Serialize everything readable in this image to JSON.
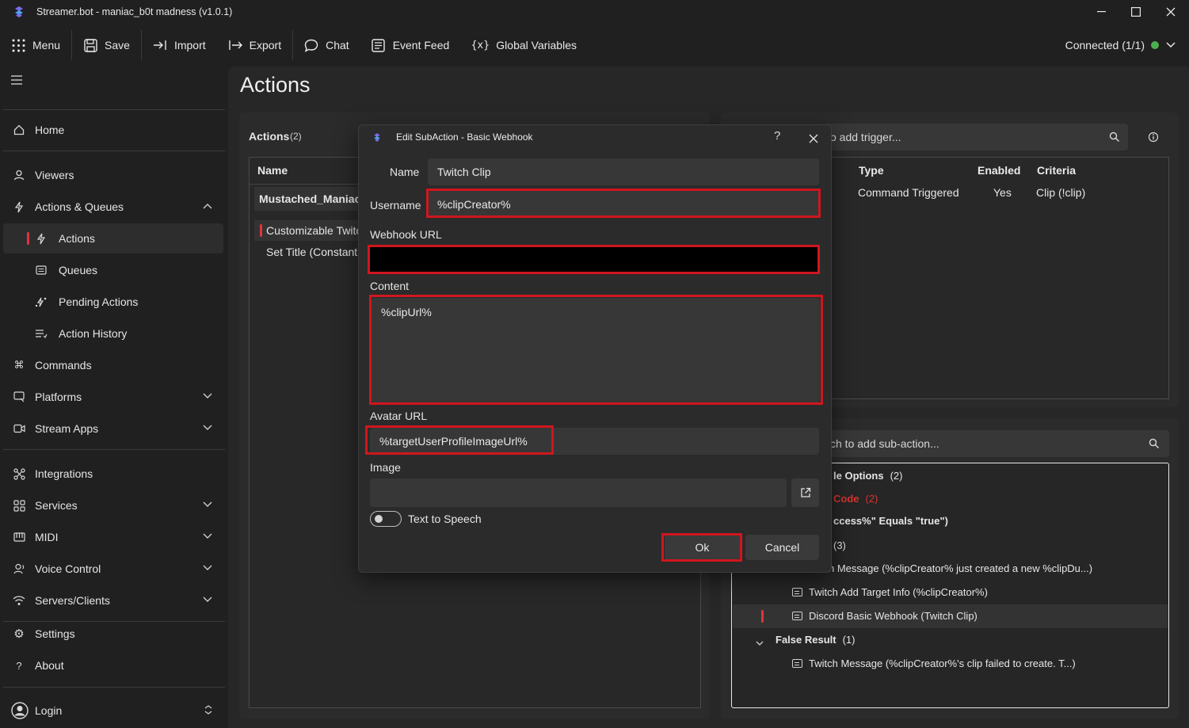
{
  "window": {
    "title": "Streamer.bot - maniac_b0t madness (v1.0.1)"
  },
  "toolbar": {
    "items": [
      {
        "label": "Menu",
        "icon": "grid-icon"
      },
      {
        "label": "Save",
        "icon": "floppy-icon"
      },
      {
        "label": "Import",
        "icon": "import-icon"
      },
      {
        "label": "Export",
        "icon": "export-icon"
      },
      {
        "label": "Chat",
        "icon": "chat-icon"
      },
      {
        "label": "Event Feed",
        "icon": "feed-icon"
      },
      {
        "label": "Global Variables",
        "icon": "variables-icon"
      }
    ],
    "status": "Connected (1/1)",
    "status_color": "#4caf50"
  },
  "sidebar": {
    "items": [
      {
        "label": "Home",
        "icon": "home-icon"
      },
      {
        "label": "Viewers",
        "icon": "user-icon"
      },
      {
        "label": "Actions & Queues",
        "icon": "bolt-icon"
      },
      {
        "label": "Actions",
        "icon": "bolt-icon"
      },
      {
        "label": "Queues",
        "icon": "queue-icon"
      },
      {
        "label": "Pending Actions",
        "icon": "pending-icon"
      },
      {
        "label": "Action History",
        "icon": "history-icon"
      },
      {
        "label": "Commands",
        "icon": "command-icon"
      },
      {
        "label": "Platforms",
        "icon": "platform-icon"
      },
      {
        "label": "Stream Apps",
        "icon": "camera-icon"
      },
      {
        "label": "Integrations",
        "icon": "integrations-icon"
      },
      {
        "label": "Services",
        "icon": "services-icon"
      },
      {
        "label": "MIDI",
        "icon": "midi-icon"
      },
      {
        "label": "Voice Control",
        "icon": "voice-icon"
      },
      {
        "label": "Servers/Clients",
        "icon": "server-icon"
      },
      {
        "label": "Settings",
        "icon": "gear-icon"
      },
      {
        "label": "About",
        "icon": "question-icon"
      },
      {
        "label": "Login",
        "icon": "account-icon"
      }
    ]
  },
  "page": {
    "title": "Actions"
  },
  "actions_panel": {
    "title": "Actions",
    "count": "(2)",
    "column_name": "Name",
    "group": "Mustached_Maniac",
    "rows": [
      "Customizable Twitch Clip",
      "Set Title (Constant"
    ]
  },
  "triggers_panel": {
    "search_placeholder": "o add trigger...",
    "columns": [
      "Type",
      "Enabled",
      "Criteria"
    ],
    "row": {
      "type": "Command Triggered",
      "enabled": "Yes",
      "criteria": "Clip (!clip)"
    }
  },
  "subactions_panel": {
    "search_placeholder": "ch to add sub-action...",
    "items": [
      {
        "label": "le Options",
        "suffix": "(2)"
      },
      {
        "label": "Code",
        "suffix": "(2)"
      },
      {
        "label": "ccess%\" Equals \"true\")",
        "suffix": ""
      },
      {
        "label": "",
        "suffix": "(3)"
      },
      {
        "label": "h Message (%clipCreator% just created a new %clipDu...)",
        "suffix": ""
      },
      {
        "label": "Twitch Add Target Info (%clipCreator%)",
        "suffix": ""
      },
      {
        "label": "Discord Basic Webhook (Twitch Clip)",
        "suffix": ""
      },
      {
        "label": "False Result",
        "suffix": "(1)"
      },
      {
        "label": "Twitch Message (%clipCreator%'s clip failed to create. T...)",
        "suffix": ""
      }
    ]
  },
  "dialog": {
    "title": "Edit SubAction - Basic Webhook",
    "help": "?",
    "name_label": "Name",
    "name_value": "Twitch Clip",
    "username_label": "Username",
    "username_value": "%clipCreator%",
    "webhook_label": "Webhook URL",
    "content_label": "Content",
    "content_value": "%clipUrl%",
    "avatar_label": "Avatar URL",
    "avatar_value": "%targetUserProfileImageUrl%",
    "image_label": "Image",
    "tts_label": "Text to Speech",
    "ok_label": "Ok",
    "cancel_label": "Cancel",
    "highlight_color": "#d0161e"
  }
}
